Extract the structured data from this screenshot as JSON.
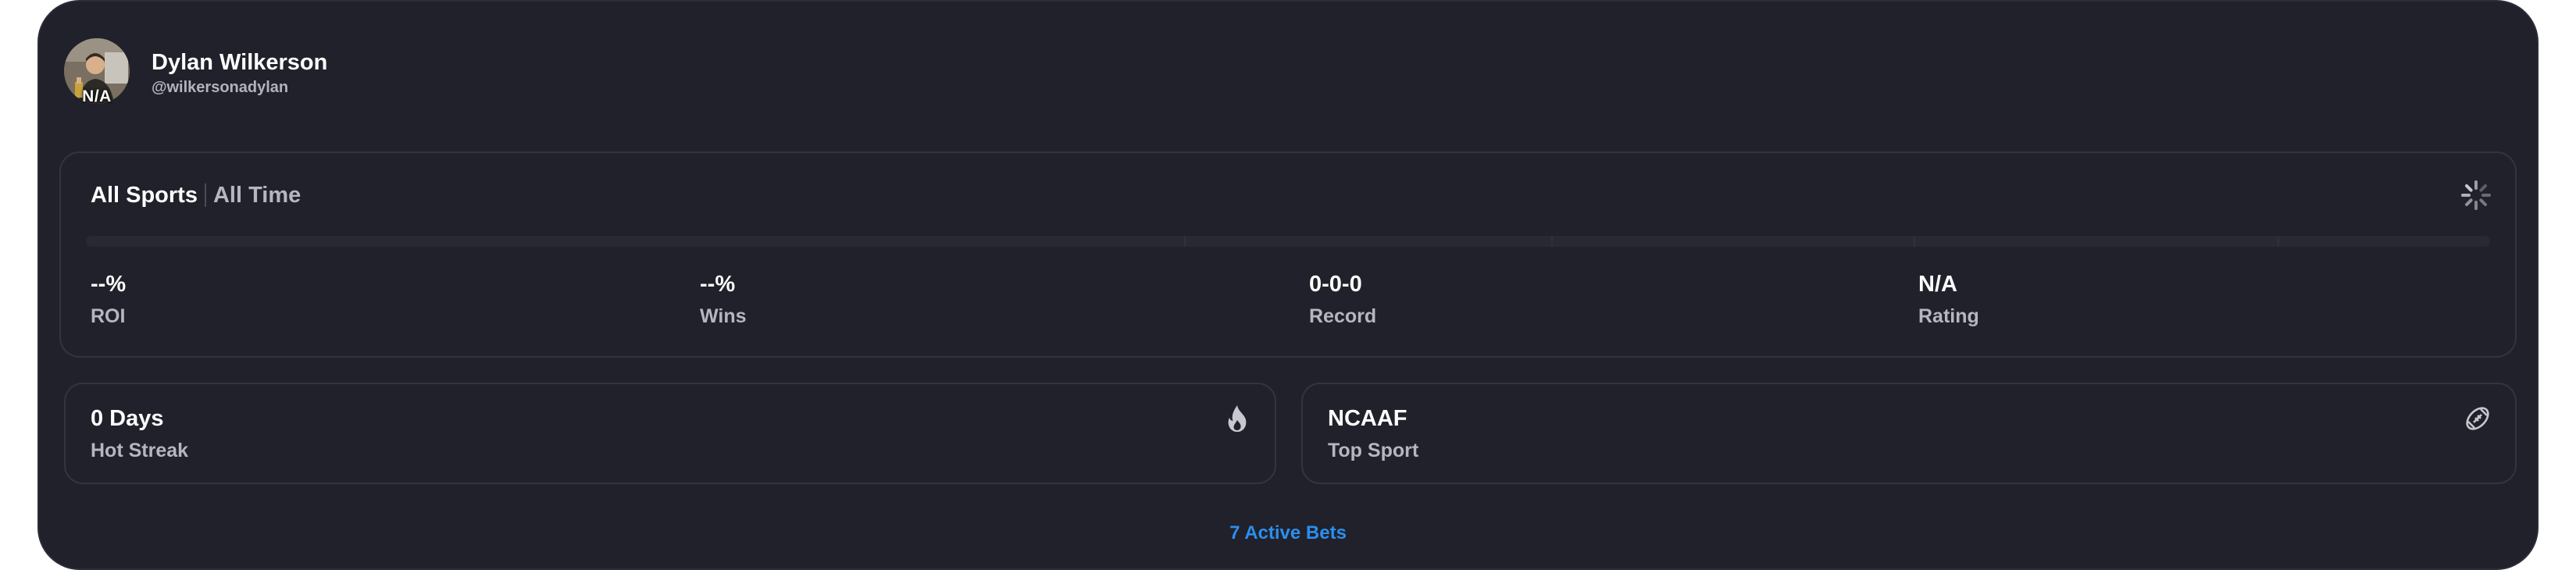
{
  "profile": {
    "name": "Dylan Wilkerson",
    "handle": "@wilkersonadylan",
    "avatar_badge": "N/A"
  },
  "filters": {
    "sport": "All Sports",
    "period": "All Time"
  },
  "stats": [
    {
      "value": "--%",
      "label": "ROI"
    },
    {
      "value": "--%",
      "label": "Wins"
    },
    {
      "value": "0-0-0",
      "label": "Record"
    },
    {
      "value": "N/A",
      "label": "Rating"
    }
  ],
  "progress": {
    "fill_fraction": 0
  },
  "cards": {
    "streak": {
      "title": "0 Days",
      "label": "Hot Streak",
      "icon": "flame-icon"
    },
    "sport": {
      "title": "NCAAF",
      "label": "Top Sport",
      "icon": "football-icon"
    }
  },
  "footer": {
    "active_bets": "7 Active Bets"
  },
  "colors": {
    "background": "#20212a",
    "border": "#33343f",
    "text_primary": "#ffffff",
    "text_secondary": "#b5b6be",
    "link": "#2b8ef0"
  }
}
